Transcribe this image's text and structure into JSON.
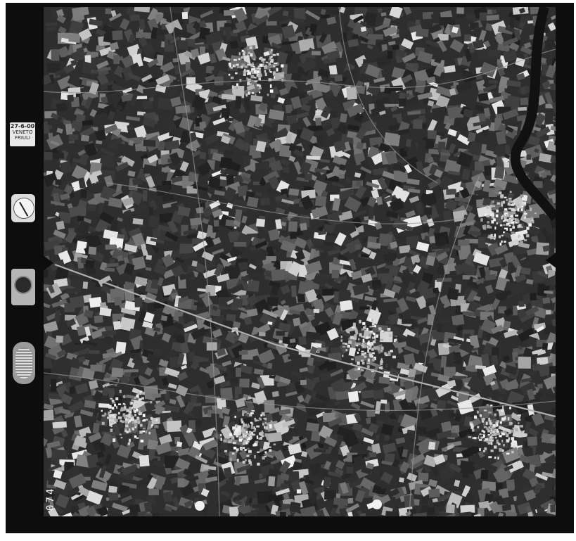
{
  "image": {
    "type": "aerial-photograph",
    "tone": "black-and-white",
    "subject": "agricultural plain with villages, roads, a railway and a river"
  },
  "annotations": {
    "stamp_date": "27-6-00",
    "stamp_region_1": "VENETO",
    "stamp_region_2": "FRIULI",
    "frame_number": "074"
  },
  "colors": {
    "frame": "#0d0d0d",
    "field_dark": "#2e2e2e",
    "field_mid": "#5a5a5a",
    "field_light": "#bdbdbd",
    "road": "#9a9a9a"
  }
}
